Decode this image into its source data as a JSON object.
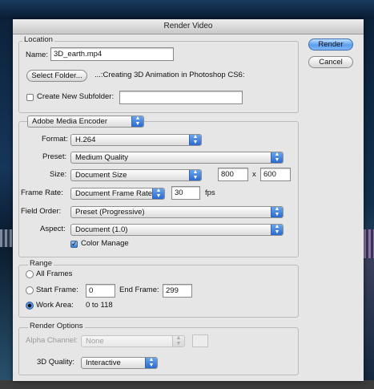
{
  "dialog": {
    "title": "Render Video"
  },
  "buttons": {
    "render": "Render",
    "cancel": "Cancel"
  },
  "location": {
    "legend": "Location",
    "name_label": "Name:",
    "name_value": "3D_earth.mp4",
    "select_folder": "Select Folder...",
    "folder_path": "...:Creating 3D Animation in Photoshop CS6:",
    "create_subfolder_label": "Create New Subfolder:",
    "create_subfolder_checked": false,
    "subfolder_value": ""
  },
  "encoder": {
    "selected": "Adobe Media Encoder",
    "format_label": "Format:",
    "format_value": "H.264",
    "preset_label": "Preset:",
    "preset_value": "Medium Quality",
    "size_label": "Size:",
    "size_value": "Document Size",
    "width": "800",
    "times": "x",
    "height": "600",
    "frame_rate_label": "Frame Rate:",
    "frame_rate_value": "Document Frame Rate",
    "fps_value": "30",
    "fps_unit": "fps",
    "field_order_label": "Field Order:",
    "field_order_value": "Preset (Progressive)",
    "aspect_label": "Aspect:",
    "aspect_value": "Document (1.0)",
    "color_manage_label": "Color Manage",
    "color_manage_checked": true
  },
  "range": {
    "legend": "Range",
    "all_frames": "All Frames",
    "start_frame_label": "Start Frame:",
    "start_frame_value": "0",
    "end_frame_label": "End Frame:",
    "end_frame_value": "299",
    "work_area_label": "Work Area:",
    "work_area_value": "0 to 118",
    "selected": "Work Area"
  },
  "render_options": {
    "legend": "Render Options",
    "alpha_channel_label": "Alpha Channel:",
    "alpha_channel_value": "None",
    "quality_label": "3D Quality:",
    "quality_value": "Interactive"
  },
  "colors": {
    "default_button": "#5b9ef0",
    "dialog_bg": "#e6e6e6",
    "select_arrow": "#2a6ad0"
  }
}
